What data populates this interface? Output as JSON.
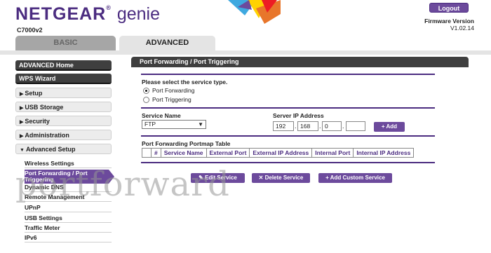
{
  "header": {
    "brand": "NETGEAR",
    "product": "genie",
    "model": "C7000v2",
    "logout_label": "Logout",
    "firmware_label": "Firmware Version",
    "firmware_version": "V1.02.14"
  },
  "tabs": [
    {
      "label": "BASIC",
      "active": false
    },
    {
      "label": "ADVANCED",
      "active": true
    }
  ],
  "sidebar": {
    "items": [
      {
        "label": "ADVANCED Home",
        "style": "dark"
      },
      {
        "label": "WPS Wizard",
        "style": "dark"
      },
      {
        "label": "Setup",
        "style": "light",
        "arrow": "▶"
      },
      {
        "label": "USB Storage",
        "style": "light",
        "arrow": "▶"
      },
      {
        "label": "Security",
        "style": "light",
        "arrow": "▶"
      },
      {
        "label": "Administration",
        "style": "light",
        "arrow": "▶"
      },
      {
        "label": "Advanced Setup",
        "style": "light",
        "arrow": "▼"
      }
    ],
    "subitems": [
      {
        "label": "Wireless Settings"
      },
      {
        "label": "Port Forwarding / Port Triggering",
        "active": true
      },
      {
        "label": "Dynamic DNS"
      },
      {
        "label": "Remote Management"
      },
      {
        "label": "UPnP"
      },
      {
        "label": "USB Settings"
      },
      {
        "label": "Traffic Meter"
      },
      {
        "label": "IPv6"
      }
    ]
  },
  "main": {
    "title": "Port Forwarding / Port Triggering",
    "service_type_prompt": "Please select the service type.",
    "radio_options": [
      {
        "label": "Port Forwarding",
        "selected": true
      },
      {
        "label": "Port Triggering",
        "selected": false
      }
    ],
    "service_name_label": "Service Name",
    "service_name_value": "FTP",
    "server_ip_label": "Server IP Address",
    "server_ip": [
      "192",
      "168",
      "0",
      ""
    ],
    "add_label": "Add",
    "table_title": "Port Forwarding Portmap Table",
    "table_headers": [
      "",
      "#",
      "Service Name",
      "External Port",
      "External IP Address",
      "Internal Port",
      "Internal IP Address"
    ],
    "edit_label": "Edit Service",
    "delete_label": "Delete Service",
    "add_custom_label": "Add Custom Service"
  },
  "watermark": "portforward",
  "colors": {
    "brand_purple": "#4b2c80",
    "button_purple": "#6c4a9c",
    "nav_dark": "#3f3f3f"
  }
}
